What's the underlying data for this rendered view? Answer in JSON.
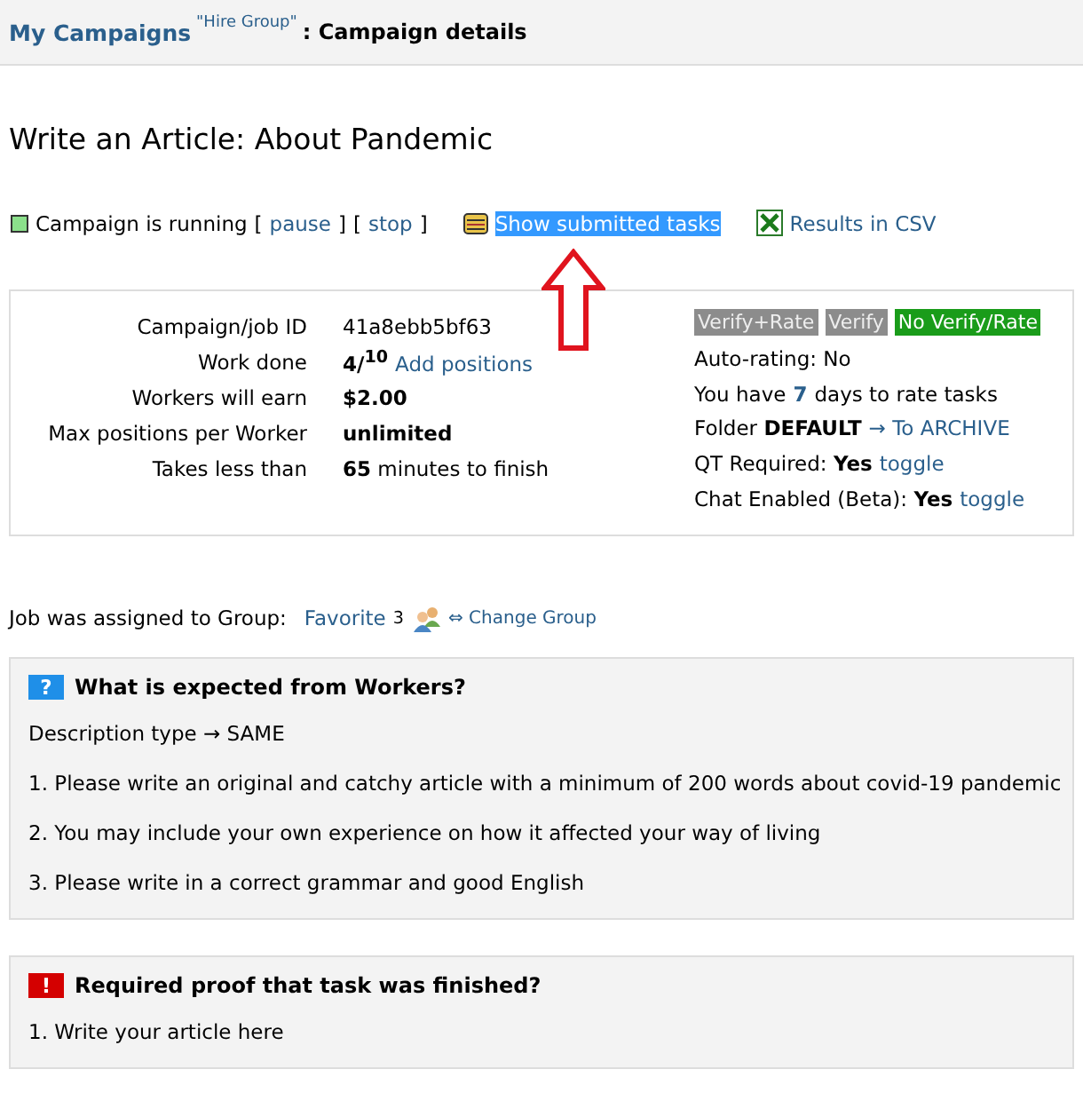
{
  "breadcrumb": {
    "link": "My Campaigns",
    "group": "\"Hire Group\"",
    "current": ": Campaign details"
  },
  "title": "Write an Article: About Pandemic",
  "status": {
    "running": true,
    "text": "Campaign is running",
    "actions": [
      {
        "kind": "bracket",
        "text": "["
      },
      {
        "kind": "link",
        "text": "pause"
      },
      {
        "kind": "bracket",
        "text": "]"
      },
      {
        "kind": "bracket",
        "text": "["
      },
      {
        "kind": "link",
        "text": "stop"
      },
      {
        "kind": "bracket",
        "text": "]"
      }
    ]
  },
  "links": [
    {
      "kind": "tasks",
      "label": "Show submitted tasks",
      "selected": true
    },
    {
      "kind": "csv",
      "label": "Results in CSV",
      "selected": false
    }
  ],
  "details": [
    {
      "label": "Campaign/job ID",
      "value": "41a8ebb5bf63",
      "bold": false
    },
    {
      "label": "Work done",
      "value": "4/$^{10}$",
      "bold": true,
      "link": "Add positions"
    },
    {
      "label": "Workers will earn",
      "value": "$2.00",
      "bold": true
    },
    {
      "label": "Max positions per Worker",
      "value": "unlimited",
      "bold": true
    },
    {
      "label": "Takes less than",
      "value": "**65** minutes to finish",
      "bold": false
    }
  ],
  "verify_options": [
    {
      "label": "Verify+Rate",
      "selected": false
    },
    {
      "label": "Verify",
      "selected": false
    },
    {
      "label": "No Verify/Rate",
      "selected": true
    }
  ],
  "settings": [
    {
      "kind": "text",
      "text": "Auto-rating: No"
    },
    {
      "kind": "days",
      "before": "You have",
      "count": "7",
      "after": "days to rate tasks"
    },
    {
      "kind": "link",
      "text": "Folder **DEFAULT**",
      "link": "→ To ARCHIVE"
    },
    {
      "kind": "link",
      "text": "QT Required: **Yes**",
      "link": "toggle"
    },
    {
      "kind": "link",
      "text": "Chat Enabled (Beta): **Yes**",
      "link": "toggle"
    }
  ],
  "group": {
    "text": "Job was assigned to Group:",
    "link": "Favorite",
    "count": "3",
    "change": "⇔ Change Group"
  },
  "sections": [
    {
      "kind": "info",
      "badge": "?",
      "title": "What is expected from Workers?",
      "lines": [
        "Description type → SAME",
        "1. Please write an original and catchy article with a minimum of 200 words about covid-19 pandemic",
        "2. You may include your own experience on how it affected your way of living",
        "3. Please write in a correct grammar and good English"
      ]
    },
    {
      "kind": "alert",
      "badge": "!",
      "title": "Required proof that task was finished?",
      "lines": [
        "1. Write your article here"
      ]
    }
  ]
}
